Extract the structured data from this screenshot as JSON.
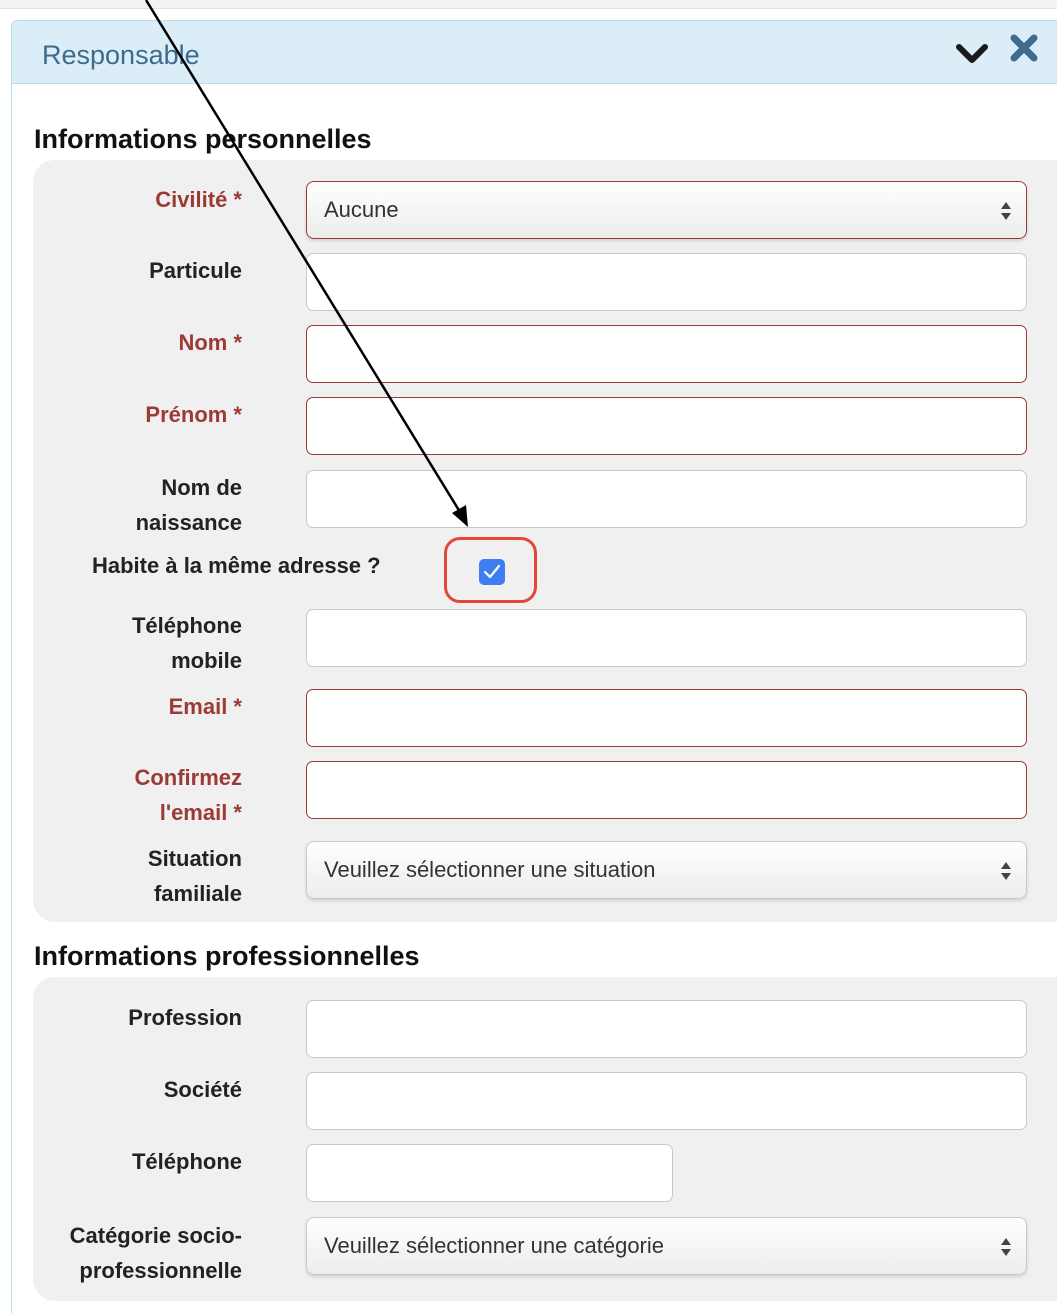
{
  "panel": {
    "title": "Responsable",
    "header_color": "#dbedf7",
    "title_color": "#3e6a8e"
  },
  "personal": {
    "section_title": "Informations personnelles",
    "civilite": {
      "label": "Civilité *",
      "value": "Aucune"
    },
    "particule": {
      "label": "Particule",
      "value": ""
    },
    "nom": {
      "label": "Nom *",
      "value": ""
    },
    "prenom": {
      "label": "Prénom *",
      "value": ""
    },
    "nom_naissance": {
      "label_line1": "Nom de",
      "label_line2": "naissance",
      "value": ""
    },
    "meme_adresse": {
      "label": "Habite à la même adresse ?",
      "checked": true
    },
    "telephone_mobile": {
      "label_line1": "Téléphone",
      "label_line2": "mobile",
      "value": ""
    },
    "email": {
      "label": "Email *",
      "value": ""
    },
    "confirm_email": {
      "label_line1": "Confirmez",
      "label_line2": "l'email *",
      "value": ""
    },
    "situation": {
      "label_line1": "Situation",
      "label_line2": "familiale",
      "value": "Veuillez sélectionner une situation"
    }
  },
  "professional": {
    "section_title": "Informations professionnelles",
    "profession": {
      "label": "Profession",
      "value": ""
    },
    "societe": {
      "label": "Société",
      "value": ""
    },
    "telephone": {
      "label": "Téléphone",
      "value": ""
    },
    "categorie": {
      "label_line1": "Catégorie socio-",
      "label_line2": "professionnelle",
      "value": "Veuillez sélectionner une catégorie"
    }
  },
  "colors": {
    "required_label": "#9c3a36",
    "checkbox": "#3d7ef0",
    "highlight_ring": "#e2483a"
  },
  "icons": {
    "collapse": "chevron-down-icon",
    "close": "close-icon",
    "select": "select-arrows-icon"
  }
}
